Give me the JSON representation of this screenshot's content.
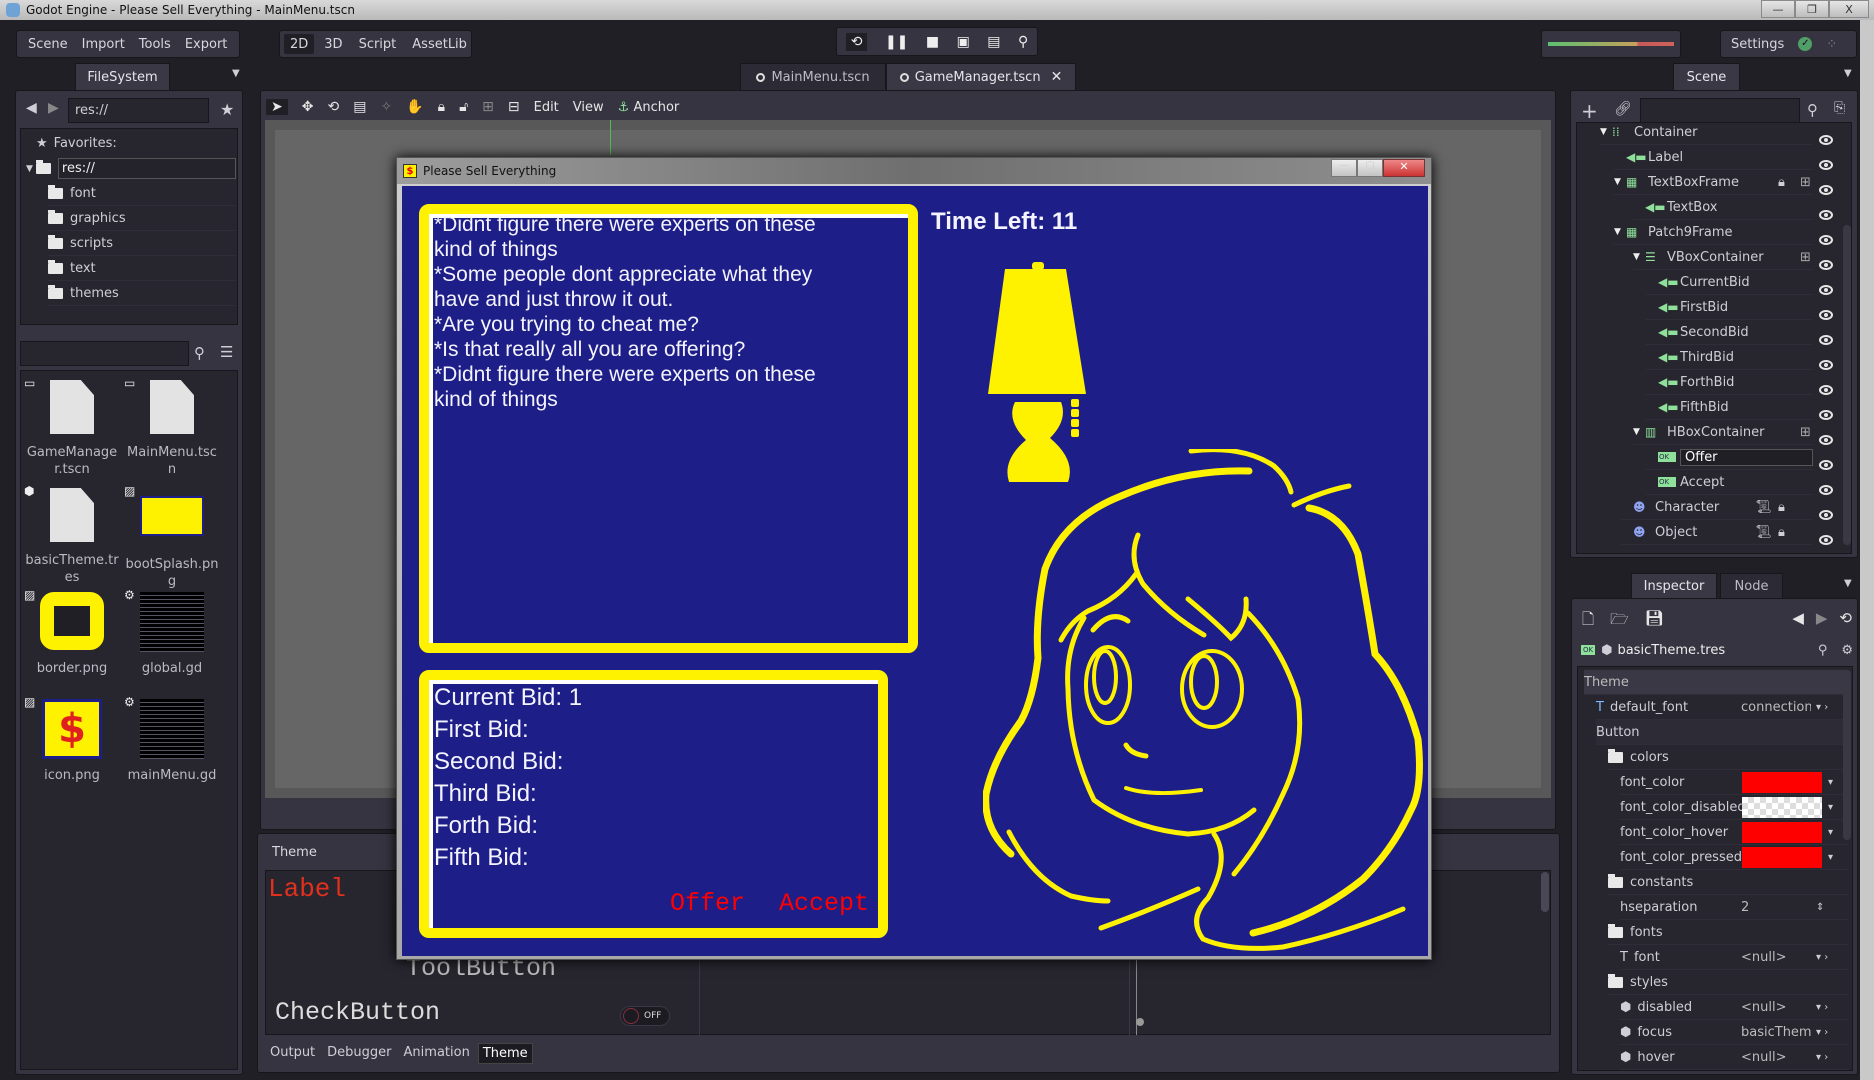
{
  "window": {
    "title": "Godot Engine - Please Sell Everything - MainMenu.tscn",
    "controls": [
      "—",
      "❐",
      "X"
    ]
  },
  "menu": [
    "Scene",
    "Import",
    "Tools",
    "Export"
  ],
  "workspaces": [
    "2D",
    "3D",
    "Script",
    "AssetLib"
  ],
  "active_workspace": "2D",
  "playback_icons": [
    "restart-icon",
    "pause-icon",
    "stop-icon",
    "play-scene-icon",
    "play-custom-icon",
    "remote-debug-icon"
  ],
  "settings": {
    "label": "Settings"
  },
  "colors": {
    "game_bg": "#1e1e88",
    "frame_yellow": "#fff200",
    "button_red": "#ff0000",
    "accent_green": "#8ee09a"
  },
  "filesystem": {
    "tab": "FileSystem",
    "path": "res://",
    "favorites": "Favorites:",
    "root": "res://",
    "folders": [
      "font",
      "graphics",
      "scripts",
      "text",
      "themes"
    ],
    "search_placeholder": "",
    "files": [
      {
        "name": "GameManager.tscn",
        "type": "scene"
      },
      {
        "name": "MainMenu.tscn",
        "type": "scene"
      },
      {
        "name": "basicTheme.tres",
        "type": "resource"
      },
      {
        "name": "bootSplash.png",
        "type": "image"
      },
      {
        "name": "border.png",
        "type": "image"
      },
      {
        "name": "global.gd",
        "type": "script"
      },
      {
        "name": "icon.png",
        "type": "image"
      },
      {
        "name": "mainMenu.gd",
        "type": "script"
      }
    ]
  },
  "scene_tabs": [
    {
      "label": "MainMenu.tscn",
      "active": false
    },
    {
      "label": "GameManager.tscn",
      "active": true
    }
  ],
  "toolbar": {
    "edit": "Edit",
    "view": "View",
    "anchor": "Anchor"
  },
  "game": {
    "title": "Please Sell Everything",
    "dialog_lines": [
      "*Didnt figure there were experts on these",
      "kind of things",
      "*Some people dont appreciate what they",
      "have and just throw it out.",
      "*Are you trying to cheat me?",
      "*Is that really all you are offering?",
      "*Didnt figure there were experts on these",
      "kind of things"
    ],
    "time_left": "Time Left: 11",
    "bids": [
      "Current Bid: 1",
      "First Bid:",
      "Second Bid:",
      "Third Bid:",
      "Forth Bid:",
      "Fifth Bid:"
    ],
    "offer": "Offer",
    "accept": "Accept"
  },
  "bottom": {
    "panel_title": "Theme",
    "preview_label": "Label",
    "tool_button": "ToolButton",
    "check_button": "CheckButton",
    "toggle_state": "OFF",
    "tabs": [
      "Output",
      "Debugger",
      "Animation",
      "Theme"
    ],
    "active_tab": "Theme"
  },
  "scene_dock": {
    "tab": "Scene",
    "nodes": [
      {
        "name": "Container",
        "icon": "container-icon",
        "depth": 0,
        "expanded": true
      },
      {
        "name": "Label",
        "icon": "label-icon",
        "depth": 1
      },
      {
        "name": "TextBoxFrame",
        "icon": "frame-icon",
        "depth": 1,
        "expanded": true,
        "lock": true,
        "pivot": true
      },
      {
        "name": "TextBox",
        "icon": "label-icon",
        "depth": 2
      },
      {
        "name": "Patch9Frame",
        "icon": "frame-icon",
        "depth": 1,
        "expanded": true
      },
      {
        "name": "VBoxContainer",
        "icon": "vbox-icon",
        "depth": 2,
        "expanded": true,
        "pivot": true
      },
      {
        "name": "CurrentBid",
        "icon": "label-icon",
        "depth": 3
      },
      {
        "name": "FirstBid",
        "icon": "label-icon",
        "depth": 3
      },
      {
        "name": "SecondBid",
        "icon": "label-icon",
        "depth": 3
      },
      {
        "name": "ThirdBid",
        "icon": "label-icon",
        "depth": 3
      },
      {
        "name": "ForthBid",
        "icon": "label-icon",
        "depth": 3
      },
      {
        "name": "FifthBid",
        "icon": "label-icon",
        "depth": 3
      },
      {
        "name": "HBoxContainer",
        "icon": "hbox-icon",
        "depth": 2,
        "expanded": true,
        "pivot": true
      },
      {
        "name": "Offer",
        "icon": "button-icon",
        "depth": 3,
        "selected": true
      },
      {
        "name": "Accept",
        "icon": "button-icon",
        "depth": 3
      },
      {
        "name": "Character",
        "icon": "sprite-icon",
        "depth": 1,
        "script": true,
        "lock": true
      },
      {
        "name": "Object",
        "icon": "sprite-icon",
        "depth": 1,
        "script": true,
        "lock": true
      }
    ]
  },
  "inspector": {
    "tabs": [
      "Inspector",
      "Node"
    ],
    "resource": "basicTheme.tres",
    "properties": [
      {
        "label": "Theme",
        "kind": "section"
      },
      {
        "label": "default_font",
        "kind": "prop",
        "depth": 1,
        "icon": "font-icon",
        "value": "connection"
      },
      {
        "label": "Button",
        "kind": "sub",
        "depth": 1
      },
      {
        "label": "colors",
        "kind": "folder",
        "depth": 2
      },
      {
        "label": "font_color",
        "kind": "color",
        "depth": 3,
        "color": "#ff0000"
      },
      {
        "label": "font_color_disabled",
        "kind": "color",
        "depth": 3,
        "color": "transparent"
      },
      {
        "label": "font_color_hover",
        "kind": "color",
        "depth": 3,
        "color": "#ff0000"
      },
      {
        "label": "font_color_pressed",
        "kind": "color",
        "depth": 3,
        "color": "#ff0000"
      },
      {
        "label": "constants",
        "kind": "folder",
        "depth": 2
      },
      {
        "label": "hseparation",
        "kind": "number",
        "depth": 3,
        "value": "2"
      },
      {
        "label": "fonts",
        "kind": "folder",
        "depth": 2
      },
      {
        "label": "font",
        "kind": "prop",
        "depth": 3,
        "icon": "font-icon",
        "value": "<null>"
      },
      {
        "label": "styles",
        "kind": "folder",
        "depth": 2
      },
      {
        "label": "disabled",
        "kind": "prop",
        "depth": 3,
        "icon": "stylebox-icon",
        "value": "<null>"
      },
      {
        "label": "focus",
        "kind": "prop",
        "depth": 3,
        "icon": "stylebox-icon",
        "value": "basicThem"
      },
      {
        "label": "hover",
        "kind": "prop",
        "depth": 3,
        "icon": "stylebox-icon",
        "value": "<null>"
      }
    ]
  }
}
